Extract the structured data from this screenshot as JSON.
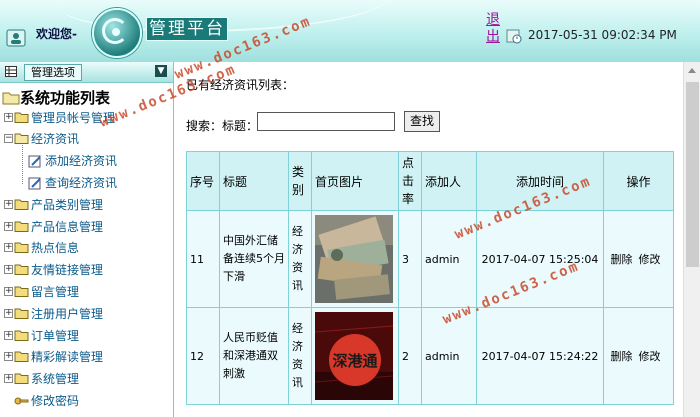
{
  "header": {
    "welcome": "欢迎您-",
    "app_title": "管理平台",
    "logout": "退出",
    "datetime": "2017-05-31 09:02:34 PM"
  },
  "sidebar": {
    "menu_tab": "管理选项",
    "root": "系统功能列表",
    "items": [
      {
        "label": "管理员帐号管理",
        "kind": "folder",
        "expanded": false
      },
      {
        "label": "经济资讯",
        "kind": "folder",
        "expanded": true
      },
      {
        "label": "添加经济资讯",
        "kind": "leaf"
      },
      {
        "label": "查询经济资讯",
        "kind": "leaf"
      },
      {
        "label": "产品类别管理",
        "kind": "folder",
        "expanded": false
      },
      {
        "label": "产品信息管理",
        "kind": "folder",
        "expanded": false
      },
      {
        "label": "热点信息",
        "kind": "folder",
        "expanded": false
      },
      {
        "label": "友情链接管理",
        "kind": "folder",
        "expanded": false
      },
      {
        "label": "留言管理",
        "kind": "folder",
        "expanded": false
      },
      {
        "label": "注册用户管理",
        "kind": "folder",
        "expanded": false
      },
      {
        "label": "订单管理",
        "kind": "folder",
        "expanded": false
      },
      {
        "label": "精彩解读管理",
        "kind": "folder",
        "expanded": false
      },
      {
        "label": "系统管理",
        "kind": "folder",
        "expanded": false
      },
      {
        "label": "修改密码",
        "kind": "key"
      }
    ]
  },
  "main": {
    "heading": "已有经济资讯列表：",
    "search_label": "搜索：标题：",
    "search_value": "",
    "search_button": "查找",
    "columns": [
      "序号",
      "标题",
      "类别",
      "首页图片",
      "点击率",
      "添加人",
      "添加时间",
      "操作"
    ],
    "rows": [
      {
        "id": "11",
        "title": "中国外汇储备连续5个月下滑",
        "category": "经济资讯",
        "image": "money-photo",
        "clicks": "3",
        "author": "admin",
        "time": "2017-04-07 15:25:04",
        "delete": "删除",
        "edit": "修改"
      },
      {
        "id": "12",
        "title": "人民币贬值和深港通双刺激",
        "category": "经济资讯",
        "image": "shenzhen-hk-connect-photo",
        "image_text": "深港通",
        "clicks": "2",
        "author": "admin",
        "time": "2017-04-07 15:24:22",
        "delete": "删除",
        "edit": "修改"
      }
    ]
  },
  "watermark": "www.doc163.com",
  "colors": {
    "accent": "#1a7a78",
    "header_bg": "#bff0ee",
    "table_header": "#d0f2f4",
    "table_cell": "#eafafd",
    "logout": "#9b169b",
    "link": "#0a5a8a"
  }
}
